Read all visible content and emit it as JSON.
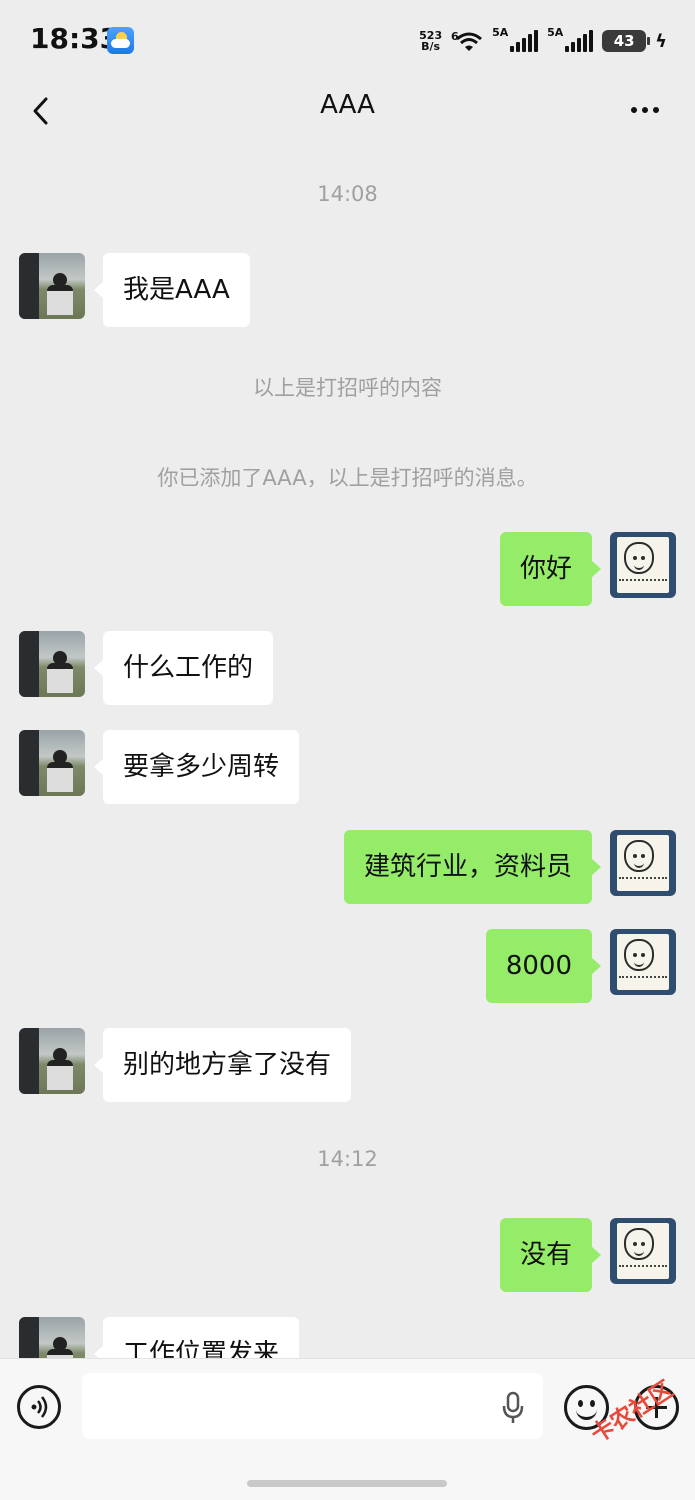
{
  "status_bar": {
    "time": "18:33",
    "net_speed_value": "523",
    "net_speed_unit": "B/s",
    "wifi_label": "6",
    "signal1_label": "5A",
    "signal2_label": "5A",
    "battery": "43",
    "icons": [
      "weather-icon",
      "wifi-icon",
      "signal-icon",
      "battery-icon",
      "charging-icon"
    ]
  },
  "nav": {
    "title": "AAA",
    "icons": [
      "back-icon",
      "more-icon"
    ]
  },
  "messages": [
    {
      "type": "time",
      "text": "14:08"
    },
    {
      "type": "in",
      "text": "我是AAA"
    },
    {
      "type": "system",
      "text": "以上是打招呼的内容"
    },
    {
      "type": "system",
      "text": "你已添加了AAA，以上是打招呼的消息。"
    },
    {
      "type": "out",
      "text": "你好"
    },
    {
      "type": "in",
      "text": "什么工作的"
    },
    {
      "type": "in",
      "text": "要拿多少周转"
    },
    {
      "type": "out",
      "text": "建筑行业，资料员"
    },
    {
      "type": "out",
      "text": "8000"
    },
    {
      "type": "in",
      "text": "别的地方拿了没有"
    },
    {
      "type": "time",
      "text": "14:12"
    },
    {
      "type": "out",
      "text": "没有"
    },
    {
      "type": "in",
      "text": "工作位置发来"
    }
  ],
  "input_bar": {
    "value": "",
    "icons": [
      "voice-icon",
      "mic-icon",
      "emoji-icon",
      "plus-icon"
    ]
  },
  "watermark": "卡农社区",
  "colors": {
    "background": "#ededed",
    "bubble_out": "#95ec69",
    "bubble_in": "#ffffff",
    "system_text": "#a0a0a0",
    "watermark": "#e64a3b"
  }
}
